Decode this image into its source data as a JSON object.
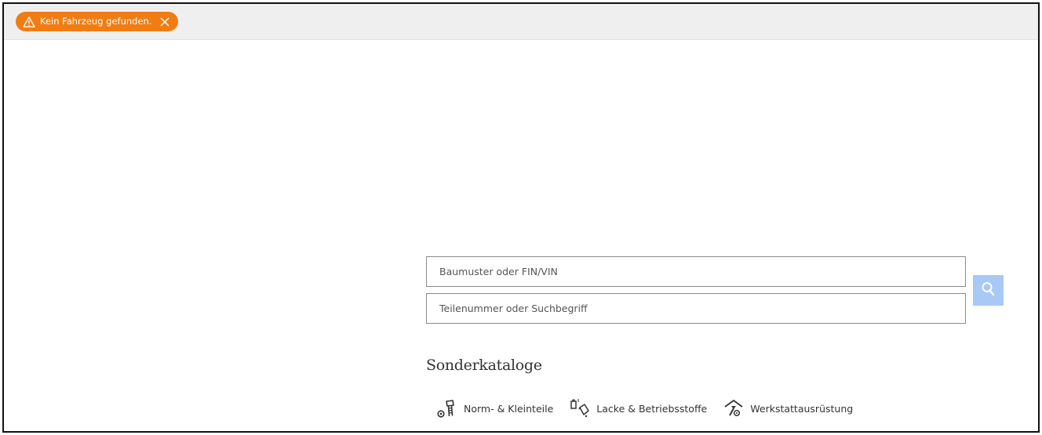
{
  "alert": {
    "text": "Kein Fahrzeug gefunden.",
    "icon": "warning-triangle-icon",
    "close_icon": "close-icon",
    "color": "#f07d14"
  },
  "search": {
    "vehicle_placeholder": "Baumuster oder FIN/VIN",
    "part_placeholder": "Teilenummer oder Suchbegriff",
    "button_icon": "search-icon",
    "button_color": "#a8c9f5"
  },
  "catalogs": {
    "title": "Sonderkataloge",
    "items": [
      {
        "label": "Norm- & Kleinteile",
        "icon": "screw-bolt-icon"
      },
      {
        "label": "Lacke & Betriebsstoffe",
        "icon": "paint-can-icon"
      },
      {
        "label": "Werkstattausrüstung",
        "icon": "workshop-tools-icon"
      }
    ]
  }
}
